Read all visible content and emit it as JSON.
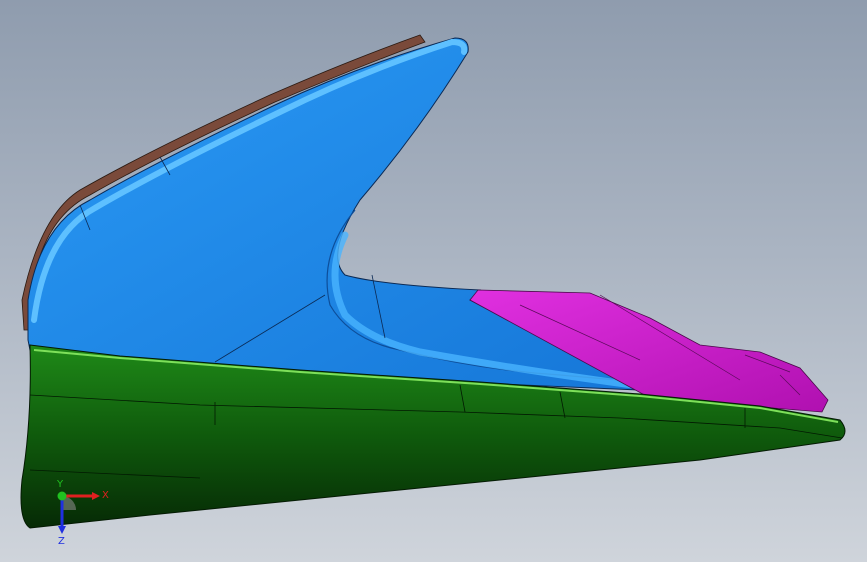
{
  "viewport": {
    "background_top": "#8f9cae",
    "background_bottom": "#cfd4db"
  },
  "model": {
    "parts": [
      {
        "name": "blue-surface",
        "color": "#1e8ff0"
      },
      {
        "name": "magenta-surface",
        "color": "#d21ed2"
      },
      {
        "name": "green-surface",
        "color": "#1a7a14"
      },
      {
        "name": "brown-edge",
        "color": "#7a4a3a"
      }
    ]
  },
  "triad": {
    "x_label": "X",
    "y_label": "Y",
    "z_label": "Z",
    "x_color": "#e02020",
    "y_color": "#20c020",
    "z_color": "#2030e0"
  }
}
